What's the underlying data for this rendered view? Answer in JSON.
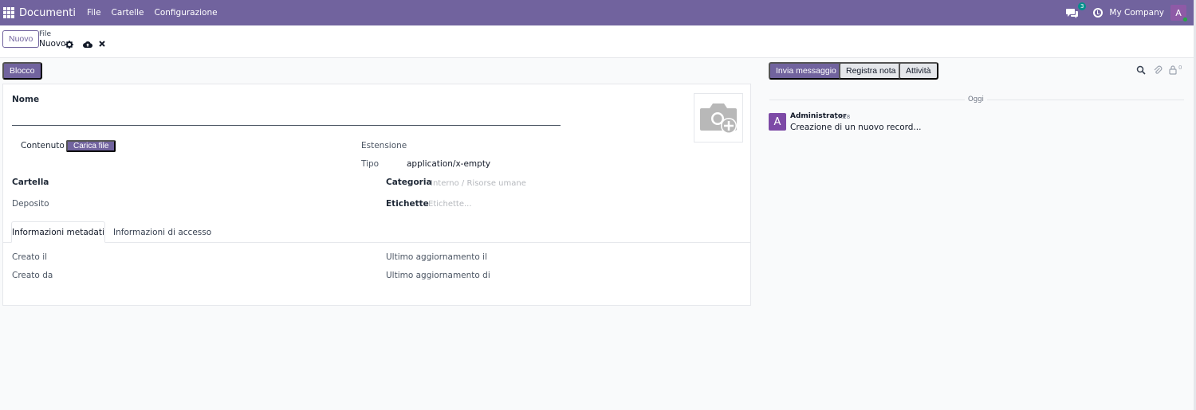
{
  "navbar": {
    "app_name": "Documenti",
    "menu": [
      "File",
      "Cartelle",
      "Configurazione"
    ],
    "chat_badge": "3",
    "company": "My Company",
    "user_initial": "A",
    "color": "#71639e"
  },
  "control": {
    "new_label": "Nuovo",
    "breadcrumb_parent": "File",
    "breadcrumb_current": "Nuovo",
    "icons": [
      "gear-icon",
      "cloud-upload-icon",
      "close-icon"
    ]
  },
  "form": {
    "status_button": "Blocco",
    "name_label": "Nome",
    "content_label": "Contenuto",
    "upload_label": "Carica file",
    "extension_label": "Estensione",
    "type_label": "Tipo",
    "type_value": "application/x-empty",
    "folder_label": "Cartella",
    "category_label": "Categoria",
    "category_placeholder": "Interno / Risorse umane",
    "storage_label": "Deposito",
    "tags_label": "Etichette",
    "tags_placeholder": "Etichette...",
    "tabs": [
      "Informazioni metadati",
      "Informazioni di accesso"
    ],
    "created_on_label": "Creato il",
    "created_by_label": "Creato da",
    "last_update_on_label": "Ultimo aggiornamento il",
    "last_update_by_label": "Ultimo aggiornamento di"
  },
  "chatter": {
    "send_message": "Invia messaggio",
    "log_note": "Registra nota",
    "activities": "Attività",
    "follower_count": "0",
    "today": "Oggi",
    "message": {
      "avatar": "A",
      "author": "Administrator",
      "time": "17:28",
      "body": "Creazione di un nuovo record..."
    }
  }
}
